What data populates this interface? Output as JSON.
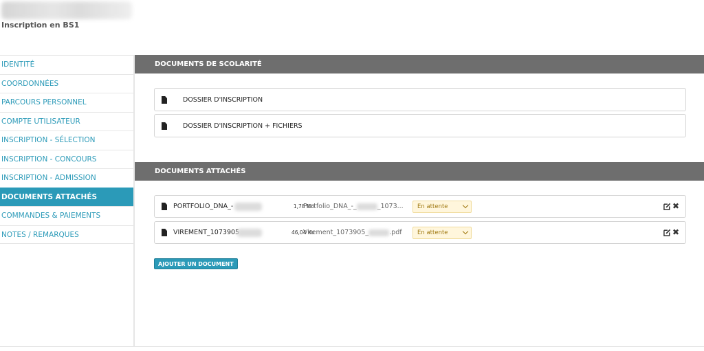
{
  "header": {
    "subtitle": "Inscription en BS1"
  },
  "sidebar": {
    "items": [
      {
        "label": "IDENTITÉ",
        "active": false
      },
      {
        "label": "COORDONNÉES",
        "active": false
      },
      {
        "label": "PARCOURS PERSONNEL",
        "active": false
      },
      {
        "label": "COMPTE UTILISATEUR",
        "active": false
      },
      {
        "label": "INSCRIPTION - SÉLECTION",
        "active": false
      },
      {
        "label": "INSCRIPTION - CONCOURS",
        "active": false
      },
      {
        "label": "INSCRIPTION - ADMISSION",
        "active": false
      },
      {
        "label": "DOCUMENTS ATTACHÉS",
        "active": true
      },
      {
        "label": "COMMANDES & PAIEMENTS",
        "active": false
      },
      {
        "label": "NOTES / REMARQUES",
        "active": false
      }
    ]
  },
  "scolarite": {
    "title": "DOCUMENTS DE SCOLARITÉ",
    "docs": [
      {
        "label": "DOSSIER D'INSCRIPTION"
      },
      {
        "label": "DOSSIER D'INSCRIPTION + FICHIERS"
      }
    ]
  },
  "attached": {
    "title": "DOCUMENTS ATTACHÉS",
    "rows": [
      {
        "name": "PORTFOLIO_DNA_-",
        "size": "1,78 Mo",
        "original_prefix": "Portfolio_DNA_-_",
        "original_suffix": "_1073...",
        "status": "En attente"
      },
      {
        "name": "VIREMENT_1073905",
        "size": "46,04 Ko",
        "original_prefix": "Virement_1073905_",
        "original_suffix": ".pdf",
        "status": "En attente"
      }
    ],
    "add_label": "AJOUTER UN DOCUMENT"
  },
  "colors": {
    "accent": "#2b9ab8",
    "section_header": "#6e6e6e",
    "status_bg": "#fff6dc"
  },
  "icons": {
    "file": "file-icon",
    "edit": "edit-icon",
    "delete": "close-icon"
  }
}
